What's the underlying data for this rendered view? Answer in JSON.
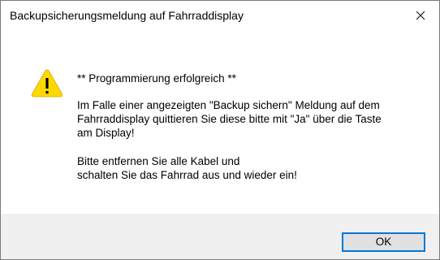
{
  "window": {
    "title": "Backupsicherungsmeldung auf Fahrraddisplay",
    "close_icon": "close-icon"
  },
  "message": {
    "icon": "warning-icon",
    "line1": "** Programmierung erfolgreich **",
    "line2": "Im Falle einer angezeigten \"Backup sichern\" Meldung auf dem",
    "line3": "Fahrraddisplay quittieren Sie diese bitte mit \"Ja\" über die Taste",
    "line4": "am Display!",
    "line5": "Bitte entfernen Sie alle Kabel und",
    "line6": "schalten Sie das Fahrrad aus und wieder ein!"
  },
  "buttons": {
    "ok_label": "OK"
  },
  "colors": {
    "footer_bg": "#f0f0f0",
    "accent": "#0078d7",
    "warning_yellow": "#ffd800"
  }
}
